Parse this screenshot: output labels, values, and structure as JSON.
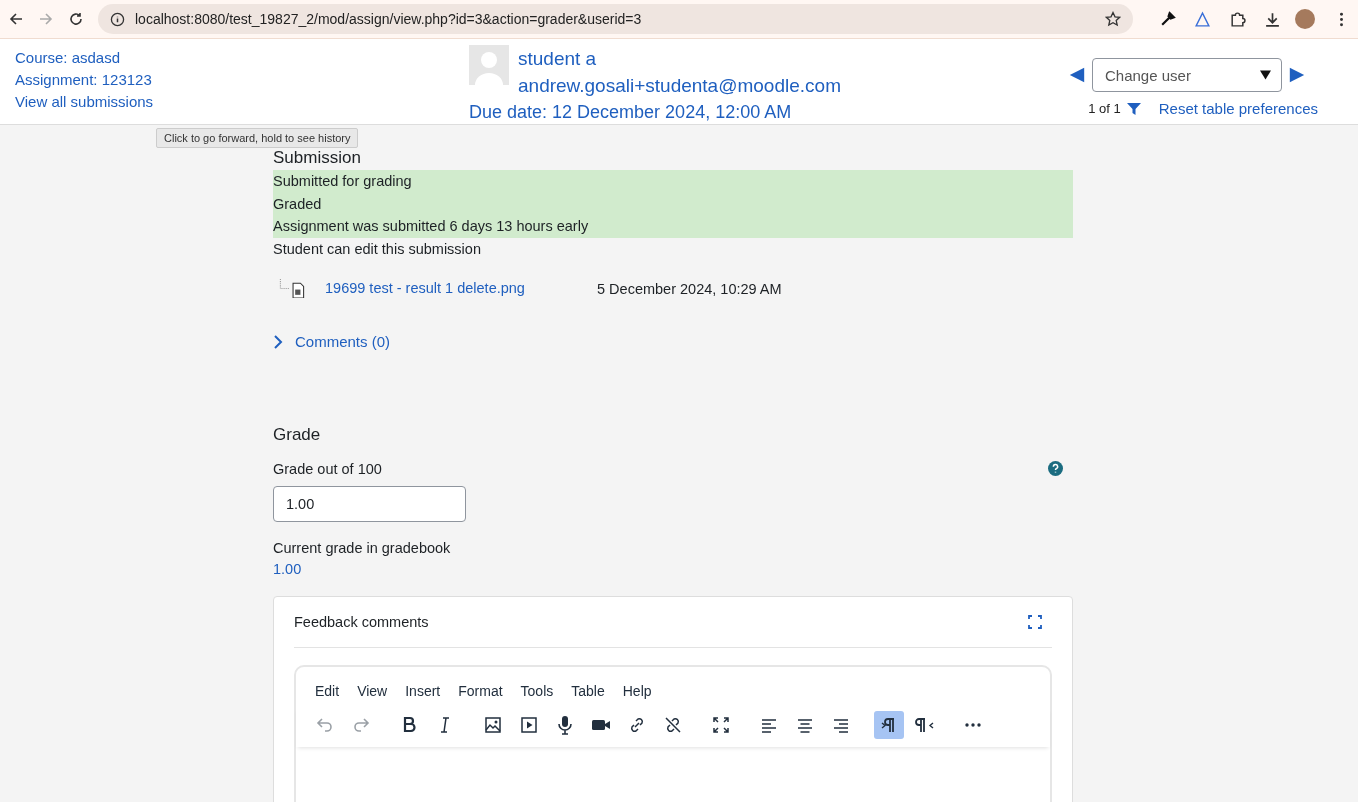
{
  "browser": {
    "url": "localhost:8080/test_19827_2/mod/assign/view.php?id=3&action=grader&userid=3",
    "forward_disabled": true,
    "tooltip": "Click to go forward, hold to see history"
  },
  "header": {
    "links": [
      "Course: asdasd",
      "Assignment: 123123",
      "View all submissions"
    ],
    "user": {
      "name": "student a",
      "email": "andrew.gosali+studenta@moodle.com",
      "due": "Due date: 12 December 2024, 12:00 AM"
    },
    "change_user": {
      "placeholder": "Change user"
    },
    "count": "1 of 1",
    "reset": "Reset table preferences"
  },
  "submission": {
    "title": "Submission",
    "status": [
      {
        "text": "Submitted for grading",
        "highlighted": true
      },
      {
        "text": "Graded",
        "highlighted": true
      },
      {
        "text": "Assignment was submitted 6 days 13 hours early",
        "highlighted": true
      },
      {
        "text": "Student can edit this submission",
        "highlighted": false
      }
    ],
    "file": {
      "name": "19699 test - result 1 delete.png",
      "date": "5 December 2024, 10:29 AM"
    },
    "comments": {
      "label": "Comments (0)",
      "expanded": false
    }
  },
  "grade": {
    "title": "Grade",
    "label": "Grade out of 100",
    "value": "1.00",
    "current_label": "Current grade in gradebook",
    "current_value": "1.00"
  },
  "feedback": {
    "title": "Feedback comments",
    "menu": [
      "Edit",
      "View",
      "Insert",
      "Format",
      "Tools",
      "Table",
      "Help"
    ],
    "toolbar": [
      [
        {
          "kind": "undo",
          "disabled": true,
          "selected": false
        },
        {
          "kind": "redo",
          "disabled": true,
          "selected": false
        }
      ],
      [
        {
          "kind": "bold",
          "disabled": false,
          "selected": false
        },
        {
          "kind": "italic",
          "disabled": false,
          "selected": false
        }
      ],
      [
        {
          "kind": "image",
          "disabled": false,
          "selected": false
        },
        {
          "kind": "media",
          "disabled": false,
          "selected": false
        },
        {
          "kind": "audio",
          "disabled": false,
          "selected": false
        },
        {
          "kind": "video",
          "disabled": false,
          "selected": false
        },
        {
          "kind": "link",
          "disabled": false,
          "selected": false
        },
        {
          "kind": "unlink",
          "disabled": false,
          "selected": false
        }
      ],
      [
        {
          "kind": "fullscreen",
          "disabled": false,
          "selected": false
        }
      ],
      [
        {
          "kind": "align-left",
          "disabled": false,
          "selected": false
        },
        {
          "kind": "align-center",
          "disabled": false,
          "selected": false
        },
        {
          "kind": "align-right",
          "disabled": false,
          "selected": false
        }
      ],
      [
        {
          "kind": "ltr",
          "disabled": false,
          "selected": true
        },
        {
          "kind": "rtl",
          "disabled": false,
          "selected": false
        }
      ],
      [
        {
          "kind": "more",
          "disabled": false,
          "selected": false
        }
      ]
    ]
  }
}
